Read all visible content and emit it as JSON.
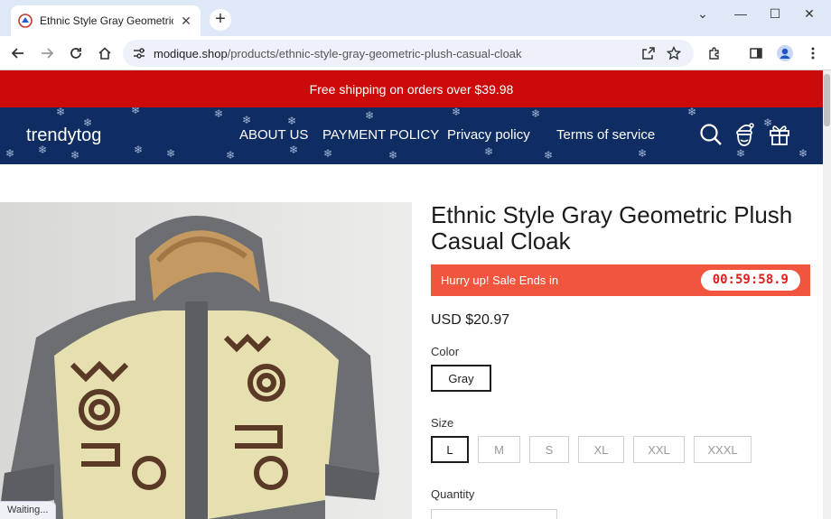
{
  "browser": {
    "tab_title": "Ethnic Style Gray Geometric Plush Casual Cloak",
    "url_host": "modique.shop",
    "url_path": "/products/ethnic-style-gray-geometric-plush-casual-cloak",
    "status_text": "Waiting..."
  },
  "announcement": "Free shipping on orders over $39.98",
  "header": {
    "logo": "trendytog",
    "nav": [
      "ABOUT US",
      "PAYMENT POLICY",
      "Privacy policy",
      "Terms of service"
    ]
  },
  "product": {
    "title": "Ethnic Style Gray Geometric Plush Casual Cloak",
    "sale_text": "Hurry up! Sale Ends in",
    "timer": "00:59:58.9",
    "price": "USD $20.97",
    "color_label": "Color",
    "colors": [
      "Gray"
    ],
    "size_label": "Size",
    "sizes": [
      "L",
      "M",
      "S",
      "XL",
      "XXL",
      "XXXL"
    ],
    "quantity_label": "Quantity"
  },
  "colors": {
    "announce_bg": "#cc0a0a",
    "header_bg": "#102d63",
    "sale_bg": "#f2553d",
    "timer_text": "#e11d1d"
  }
}
